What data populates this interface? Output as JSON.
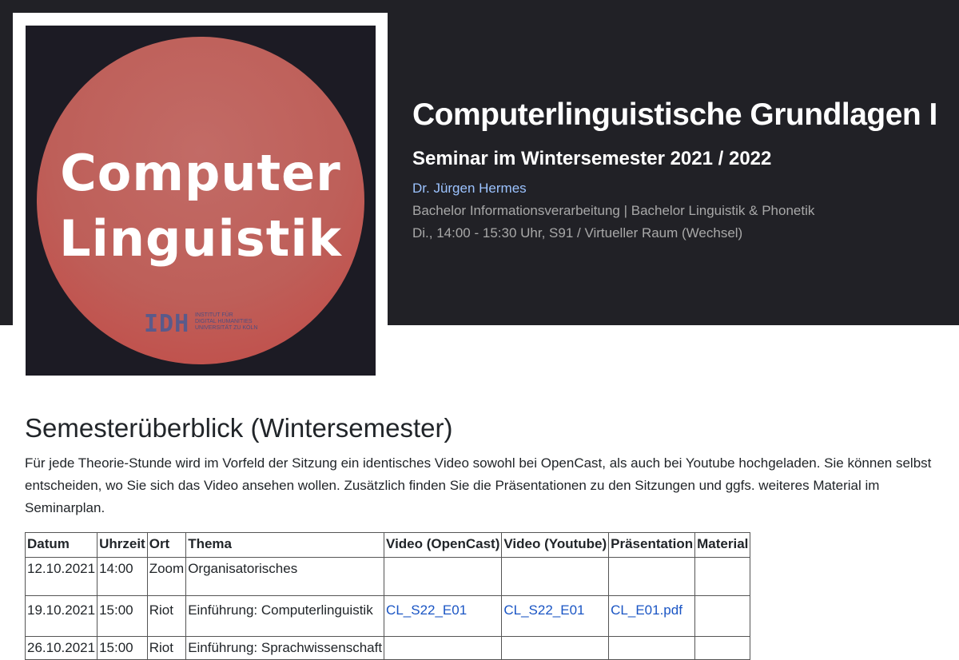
{
  "logo": {
    "line1": "Computer",
    "line2": "Linguistik",
    "institute_mark": "IDH",
    "institute_lines": [
      "Institut für",
      "Digital Humanities",
      "Universität zu Köln"
    ]
  },
  "header": {
    "title": "Computerlinguistische Grundlagen I",
    "subtitle": "Seminar im Wintersemester 2021 / 2022",
    "lecturer": "Dr. Jürgen Hermes",
    "programs": "Bachelor Informationsverarbeitung | Bachelor Linguistik & Phonetik",
    "schedule": "Di., 14:00 - 15:30 Uhr, S91 / Virtueller Raum (Wechsel)"
  },
  "overview": {
    "title": "Semesterüberblick (Wintersemester)",
    "intro": "Für jede Theorie-Stunde wird im Vorfeld der Sitzung ein identisches Video sowohl bei OpenCast, als auch bei Youtube hochgeladen. Sie können selbst entscheiden, wo Sie sich das Video ansehen wollen. Zusätzlich finden Sie die Präsentationen zu den Sitzungen und ggfs. weiteres Material im Seminarplan."
  },
  "table": {
    "headers": [
      "Datum",
      "Uhrzeit",
      "Ort",
      "Thema",
      "Video (OpenCast)",
      "Video (Youtube)",
      "Präsentation",
      "Material"
    ],
    "rows": [
      [
        "12.10.2021",
        "14:00",
        "Zoom",
        "Organisatorisches",
        "",
        "",
        "",
        ""
      ],
      [
        "19.10.2021",
        "15:00",
        "Riot",
        "Einführung: Computerlinguistik",
        "CL_S22_E01",
        "CL_S22_E01",
        "CL_E01.pdf",
        ""
      ],
      [
        "26.10.2021",
        "15:00",
        "Riot",
        "Einführung: Sprachwissenschaft",
        "",
        "",
        "",
        ""
      ]
    ]
  },
  "colors": {
    "header_bg": "#212126",
    "lecturer_link": "#9cc3ff",
    "table_link": "#1a55c4",
    "logo_circle": "#be5f59"
  }
}
